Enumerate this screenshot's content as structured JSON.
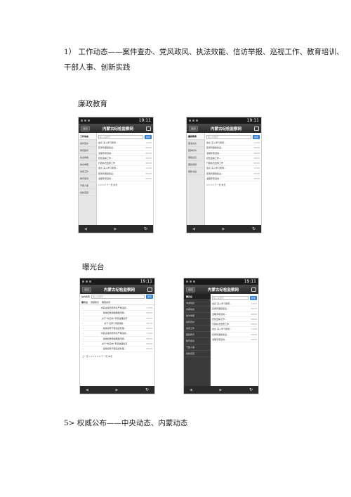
{
  "paragraphs": {
    "p1_line1": "1） 工作动态——案件查办、党风政风、执法效能、信访举报、巡视工作、教育培训、",
    "p1_line2": "干部人事、创新实践",
    "label_lianzheng": "廉政教育",
    "label_baoguang": "曝光台",
    "p5": "5>  权威公布——中央动态、内蒙动态"
  },
  "phone_common": {
    "time": "19:11",
    "title": "内蒙古纪检监察网",
    "back": "返回",
    "search_placeholder": "输入关键字",
    "search_button": "搜索"
  },
  "phone1": {
    "menu": [
      "工作动态",
      "案件查办",
      "党风政风",
      "执法效能",
      "信访举报",
      "巡视工作",
      "教育培训",
      "干部人事",
      "创新实践"
    ],
    "rows": [
      {
        "t": "会议  深入学习贯彻...",
        "d": "11/08"
      },
      {
        "t": "区党风廉政建设...",
        "d": "08/08"
      },
      {
        "t": "治理专项活动...",
        "d": "08/08"
      },
      {
        "t": "纪检监察工作...",
        "d": "08/08"
      },
      {
        "t": "行政执法监督工作",
        "d": "08/08"
      },
      {
        "t": "会议  深入学习贯彻...",
        "d": "11/08"
      },
      {
        "t": "区党风廉政建设...",
        "d": "08/08"
      },
      {
        "t": "治理专项活动...",
        "d": "08/08"
      }
    ],
    "pager": "1  2  3  4  下一页  末页"
  },
  "phone2": {
    "menu": [
      "廉政教育",
      "廉洁文化",
      "警钟长鸣",
      "廉政论坛",
      "廉政视频",
      "廉政书画"
    ],
    "rows": [
      {
        "t": "会议  深入学习贯彻...",
        "d": "11/08"
      },
      {
        "t": "区党风廉政建设...",
        "d": "08/08"
      },
      {
        "t": "治理专项活动...",
        "d": "08/08"
      },
      {
        "t": "纪检监察工作...",
        "d": "08/08"
      },
      {
        "t": "行政执法监督工作",
        "d": "08/08"
      },
      {
        "t": "会议  深入学习贯彻...",
        "d": "11/08"
      },
      {
        "t": "区党风廉政建设...",
        "d": "08/08"
      },
      {
        "t": "治理专项活动...",
        "d": "08/08"
      }
    ],
    "pager": "1  2  3  4  下一页  末页"
  },
  "phone3": {
    "search_label": "站内搜索",
    "tabs": [
      "曝光台",
      "通报曝光",
      "典型案例"
    ],
    "rows": [
      {
        "t": "内蒙古某局原局长严重违纪...",
        "d": "11/08"
      },
      {
        "t": "某地纪委通报典型问题...",
        "d": "08/08"
      },
      {
        "t": "关于“吃空饷”专项治理情况",
        "d": "08/08"
      },
      {
        "t": "关于“四风”问题通报...",
        "d": "08/08"
      },
      {
        "t": "某旗领导干部违纪处理...",
        "d": "08/08"
      },
      {
        "t": "内蒙古某局原局长严重违纪...",
        "d": "11/08"
      },
      {
        "t": "某地纪委通报典型问题...",
        "d": "08/08"
      },
      {
        "t": "关于“吃空饷”专项治理情况",
        "d": "08/08"
      },
      {
        "t": "某旗领导干部违纪处理...",
        "d": "08/08"
      }
    ],
    "pager": "上一页  1  2  3  4  5  6  下一页  末页"
  },
  "phone4": {
    "menu": [
      "曝光台",
      "中央动态",
      "内蒙动态",
      "信访举报",
      "案件查办",
      "巡视工作",
      "廉政教育",
      "教育培训",
      "干部人事",
      "创新实践"
    ],
    "rows": [
      {
        "t": "会议  深入学习贯彻...",
        "d": "11/08"
      },
      {
        "t": "区党风廉政建设...",
        "d": "08/08"
      },
      {
        "t": "治理专项活动...",
        "d": "08/08"
      },
      {
        "t": "纪检监察工作...",
        "d": "08/08"
      },
      {
        "t": "行政执法监督工作",
        "d": "08/08"
      },
      {
        "t": "会议  深入学习贯彻...",
        "d": "11/08"
      },
      {
        "t": "区党风廉政建设...",
        "d": "08/08"
      },
      {
        "t": "治理专项活动...",
        "d": "08/08"
      }
    ]
  }
}
